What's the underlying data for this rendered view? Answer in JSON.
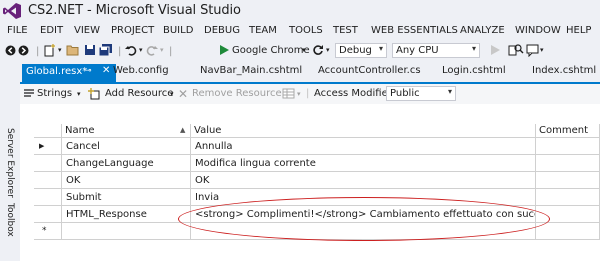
{
  "window": {
    "title": "CS2.NET - Microsoft Visual Studio"
  },
  "menu": [
    "FILE",
    "EDIT",
    "VIEW",
    "PROJECT",
    "BUILD",
    "DEBUG",
    "TEAM",
    "TOOLS",
    "TEST",
    "WEB ESSENTIALS",
    "ANALYZE",
    "WINDOW",
    "HELP"
  ],
  "toolbar": {
    "browser_label": "Google Chrome",
    "config_value": "Debug",
    "platform_value": "Any CPU"
  },
  "side_panel": {
    "server_explorer": "Server Explorer",
    "toolbox": "Toolbox"
  },
  "tabs": {
    "active": "Global.resx*",
    "others": [
      "Web.config",
      "NavBar_Main.cshtml",
      "AccountController.cs",
      "Login.cshtml",
      "Index.cshtml"
    ]
  },
  "resource_toolbar": {
    "strings": "Strings",
    "add_resource": "Add Resource",
    "remove_resource": "Remove Resource",
    "access_modifier_label": "Access Modifier:",
    "access_modifier_value": "Public"
  },
  "grid": {
    "columns": [
      "Name",
      "Value",
      "Comment"
    ],
    "rows": [
      {
        "name": "Cancel",
        "value": "Annulla",
        "comment": ""
      },
      {
        "name": "ChangeLanguage",
        "value": "Modifica lingua corrente",
        "comment": ""
      },
      {
        "name": "OK",
        "value": "OK",
        "comment": ""
      },
      {
        "name": "Submit",
        "value": "Invia",
        "comment": ""
      },
      {
        "name": "HTML_Response",
        "value": "<strong> Complimenti!</strong> Cambiamento effettuato con successo.",
        "comment": ""
      }
    ],
    "current_row_marker": "▶",
    "new_row_marker": "*"
  },
  "colors": {
    "accent": "#007acc",
    "highlight": "#cc1f1f",
    "vs_purple": "#68217a"
  }
}
